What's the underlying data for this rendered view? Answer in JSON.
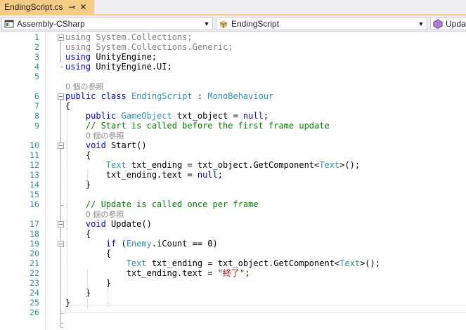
{
  "tab": {
    "title": "EndingScript.cs",
    "pin_icon": "⊸",
    "close_icon": "✕"
  },
  "nav": {
    "project": "Assembly-CSharp",
    "type": "EndingScript",
    "member": "Update()"
  },
  "code_lens": [
    "0 個の参照",
    "0 個の参照",
    "0 個の参照",
    "0 個の参照"
  ],
  "lines": [
    {
      "n": "1",
      "parts": [
        [
          "gr",
          "using"
        ],
        [
          "gr",
          " System.Collections;"
        ]
      ]
    },
    {
      "n": "2",
      "parts": [
        [
          "gr",
          "using"
        ],
        [
          "gr",
          " System.Collections.Generic;"
        ]
      ]
    },
    {
      "n": "3",
      "parts": [
        [
          "kw",
          "using"
        ],
        [
          "",
          " UnityEngine;"
        ]
      ]
    },
    {
      "n": "4",
      "parts": [
        [
          "kw",
          "using"
        ],
        [
          "",
          " UnityEngine.UI;"
        ]
      ]
    },
    {
      "n": "5",
      "parts": []
    },
    {
      "n": "6",
      "parts": [
        [
          "kw",
          "public"
        ],
        [
          "",
          " "
        ],
        [
          "kw",
          "class"
        ],
        [
          "",
          " "
        ],
        [
          "ty",
          "EndingScript"
        ],
        [
          "",
          " : "
        ],
        [
          "ty",
          "MonoBehaviour"
        ]
      ]
    },
    {
      "n": "7",
      "parts": [
        [
          "",
          "{"
        ]
      ]
    },
    {
      "n": "8",
      "parts": [
        [
          "",
          "    "
        ],
        [
          "kw",
          "public"
        ],
        [
          "",
          " "
        ],
        [
          "ty",
          "GameObject"
        ],
        [
          "",
          " txt_object = "
        ],
        [
          "kw",
          "null"
        ],
        [
          "",
          ";"
        ]
      ]
    },
    {
      "n": "9",
      "parts": [
        [
          "",
          "    "
        ],
        [
          "cm",
          "// Start is called before the first frame update"
        ]
      ]
    },
    {
      "n": "10",
      "parts": [
        [
          "",
          "    "
        ],
        [
          "kw",
          "void"
        ],
        [
          "",
          " Start()"
        ]
      ]
    },
    {
      "n": "11",
      "parts": [
        [
          "",
          "    {"
        ]
      ]
    },
    {
      "n": "12",
      "parts": [
        [
          "",
          "        "
        ],
        [
          "ty",
          "Text"
        ],
        [
          "",
          " txt_ending = txt_object.GetComponent<"
        ],
        [
          "ty",
          "Text"
        ],
        [
          "",
          ">();"
        ]
      ]
    },
    {
      "n": "13",
      "parts": [
        [
          "",
          "        txt_ending.text = "
        ],
        [
          "kw",
          "null"
        ],
        [
          "",
          ";"
        ]
      ]
    },
    {
      "n": "14",
      "parts": [
        [
          "",
          "    }"
        ]
      ]
    },
    {
      "n": "15",
      "parts": []
    },
    {
      "n": "16",
      "parts": [
        [
          "",
          "    "
        ],
        [
          "cm",
          "// Update is called once per frame"
        ]
      ]
    },
    {
      "n": "17",
      "parts": [
        [
          "",
          "    "
        ],
        [
          "kw",
          "void"
        ],
        [
          "",
          " Update()"
        ]
      ]
    },
    {
      "n": "18",
      "parts": [
        [
          "",
          "    {"
        ]
      ]
    },
    {
      "n": "19",
      "parts": [
        [
          "",
          "        "
        ],
        [
          "kw",
          "if"
        ],
        [
          "",
          " ("
        ],
        [
          "ty",
          "Enemy"
        ],
        [
          "",
          ".iCount == 0)"
        ]
      ]
    },
    {
      "n": "20",
      "parts": [
        [
          "",
          "        {"
        ]
      ]
    },
    {
      "n": "21",
      "parts": [
        [
          "",
          "            "
        ],
        [
          "ty",
          "Text"
        ],
        [
          "",
          " txt_ending = txt_object.GetComponent<"
        ],
        [
          "ty",
          "Text"
        ],
        [
          "",
          ">();"
        ]
      ]
    },
    {
      "n": "22",
      "parts": [
        [
          "",
          "            txt_ending.text = "
        ],
        [
          "st",
          "\"終了\""
        ],
        [
          "",
          ";"
        ]
      ]
    },
    {
      "n": "23",
      "parts": [
        [
          "",
          "        }"
        ]
      ]
    },
    {
      "n": "24",
      "parts": [
        [
          "",
          "    }"
        ]
      ]
    },
    {
      "n": "25",
      "parts": [
        [
          "",
          "}"
        ]
      ]
    },
    {
      "n": "26",
      "parts": []
    }
  ],
  "colors": {
    "tab_active": "#f5cc84",
    "keyword": "#0000ff",
    "type": "#2b91af",
    "comment": "#008000",
    "string": "#a31515",
    "line_number": "#2b91af"
  }
}
